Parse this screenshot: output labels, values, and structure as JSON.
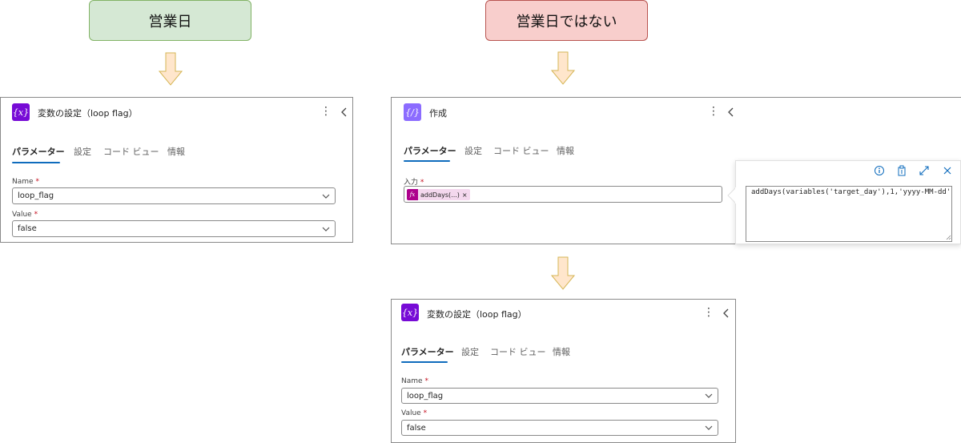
{
  "labels": {
    "business_day": "営業日",
    "not_business_day": "営業日ではない"
  },
  "panel_left": {
    "title": "変数の設定（loop flag）",
    "tabs": [
      "パラメーター",
      "設定",
      "コード ビュー",
      "情報"
    ],
    "name_label": "Name",
    "name_value": "loop_flag",
    "value_label": "Value",
    "value_value": "false",
    "required_mark": "*"
  },
  "panel_compose": {
    "title": "作成",
    "tabs": [
      "パラメーター",
      "設定",
      "コード ビュー",
      "情報"
    ],
    "input_label": "入力",
    "required_mark": "*",
    "token_label": "addDays(...)",
    "token_remove": "×",
    "token_icon": "fx",
    "expression": "addDays(variables('target_day'),1,'yyyy-MM-dd')"
  },
  "panel_bottom": {
    "title": "変数の設定（loop flag）",
    "tabs": [
      "パラメーター",
      "設定",
      "コード ビュー",
      "情報"
    ],
    "name_label": "Name",
    "name_value": "loop_flag",
    "value_label": "Value",
    "value_value": "false",
    "required_mark": "*"
  },
  "icons": {
    "variable": "{x}",
    "compose": "{/}",
    "more": "⋮"
  },
  "colors": {
    "accent": "#0f6cbd",
    "variable_icon": "#770bd6",
    "compose_icon": "#8c6cff",
    "token_bg": "#f4d8ee",
    "fx_icon": "#ad008c",
    "green_box": "#d5e8d4",
    "red_box": "#f8cecc",
    "arrow": "#ffe6cc"
  }
}
